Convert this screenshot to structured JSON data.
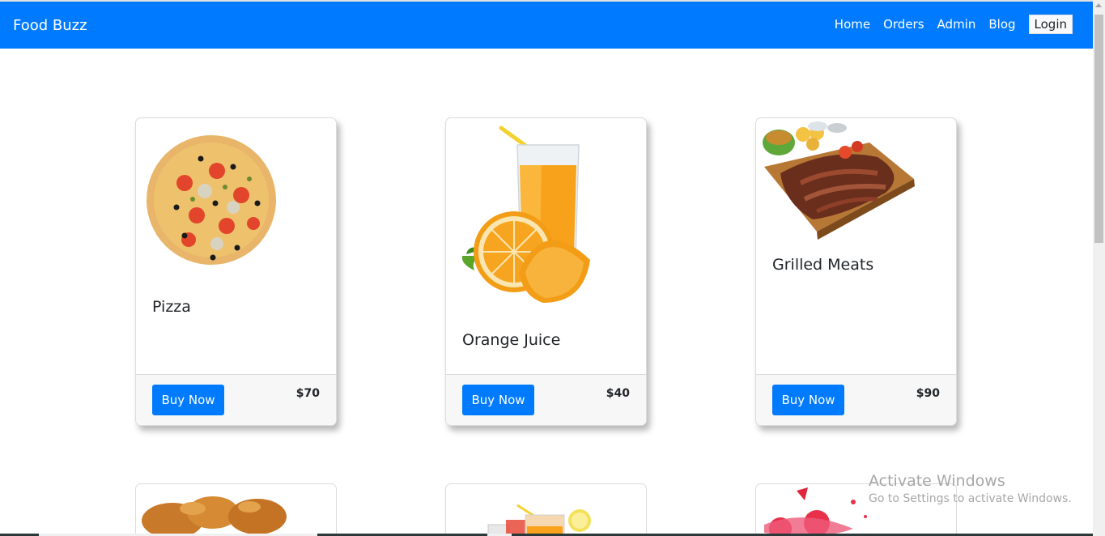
{
  "brand": "Food Buzz",
  "nav": {
    "links": [
      "Home",
      "Orders",
      "Admin",
      "Blog"
    ],
    "login_label": "Login"
  },
  "products": [
    {
      "title": "Pizza",
      "button": "Buy Now",
      "price": "$70",
      "icon": "pizza-image"
    },
    {
      "title": "Orange Juice",
      "button": "Buy Now",
      "price": "$40",
      "icon": "orange-juice-image"
    },
    {
      "title": "Grilled Meats",
      "button": "Buy Now",
      "price": "$90",
      "icon": "grilled-meats-image"
    }
  ],
  "products_row2": [
    {
      "icon": "fried-chicken-image"
    },
    {
      "icon": "juice-glasses-image"
    },
    {
      "icon": "strawberry-splash-image"
    }
  ],
  "watermark": {
    "line1": "Activate Windows",
    "line2": "Go to Settings to activate Windows."
  },
  "colors": {
    "navbar": "#007bff",
    "button": "#007bff"
  }
}
